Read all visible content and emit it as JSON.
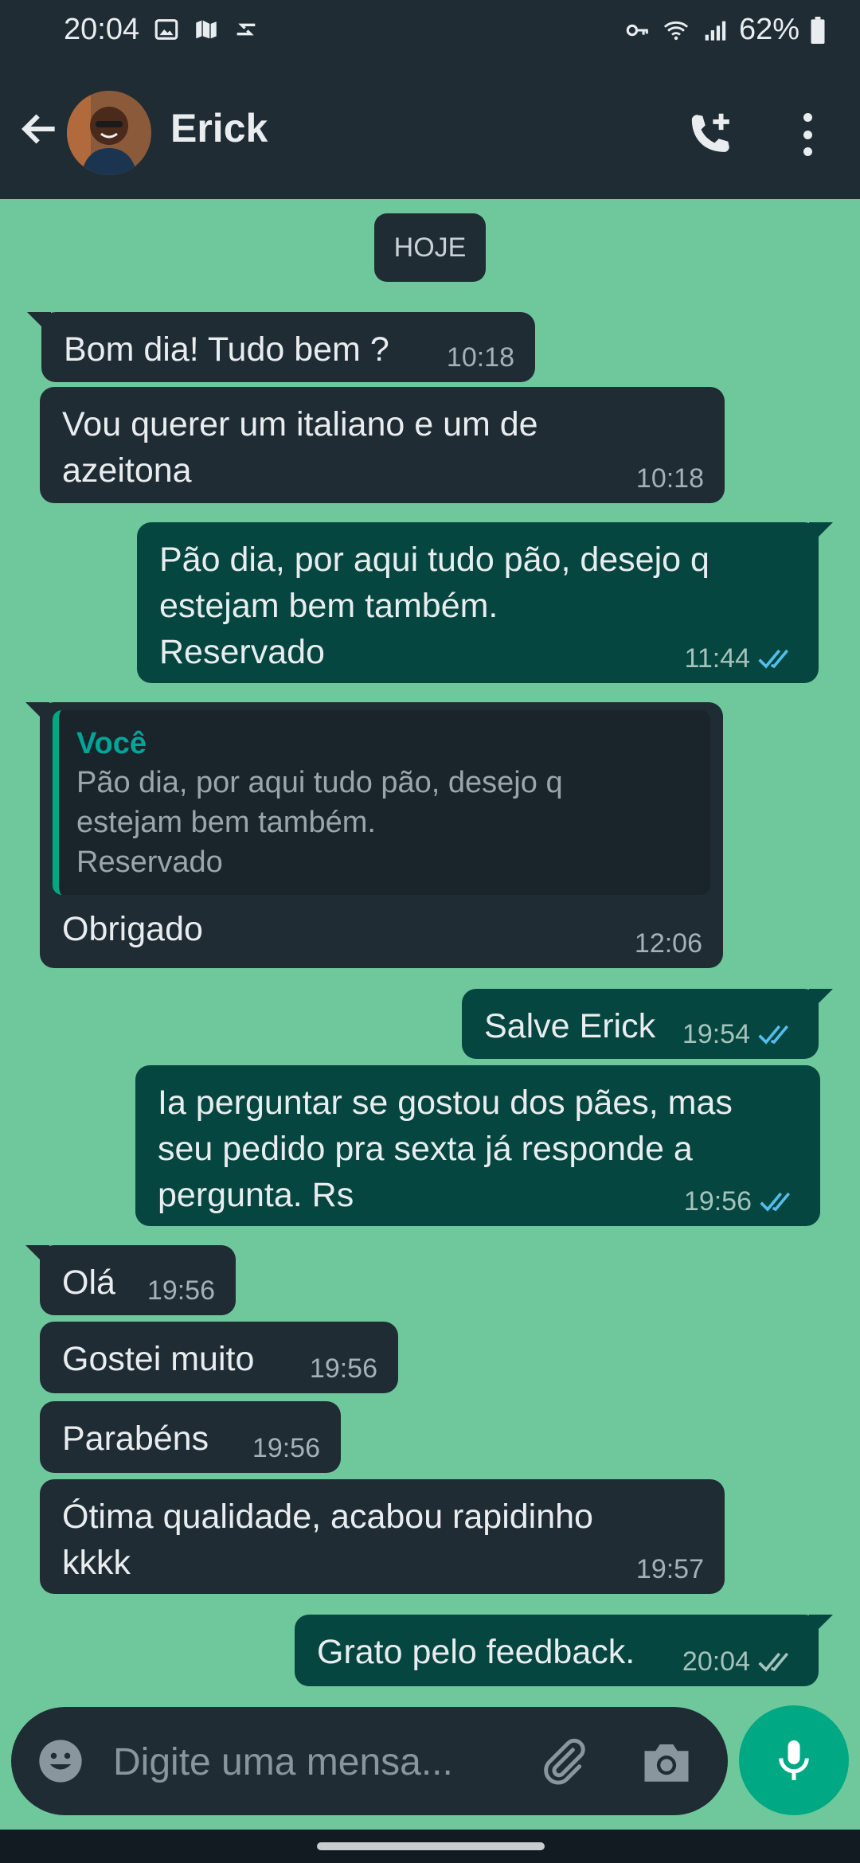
{
  "status_bar": {
    "time": "20:04",
    "battery": "62%",
    "left_icons": [
      "image-icon",
      "maps-icon",
      "transfer-icon"
    ],
    "right_icons": [
      "vpn-key-icon",
      "wifi-icon",
      "signal-icon",
      "battery-icon"
    ]
  },
  "header": {
    "contact_name": "Erick",
    "icons": [
      "back-arrow-icon",
      "add-call-icon",
      "more-vert-icon"
    ]
  },
  "date_chip": "HOJE",
  "messages": [
    {
      "direction": "in",
      "text": "Bom dia! Tudo bem ?",
      "time": "10:18"
    },
    {
      "direction": "in",
      "text": "Vou querer um italiano e um de\nazeitona",
      "time": "10:18"
    },
    {
      "direction": "out",
      "text": "Pão dia, por aqui tudo pão, desejo q\nestejam bem também.\nReservado",
      "time": "11:44",
      "status": "read"
    },
    {
      "direction": "in",
      "quote_author": "Você",
      "quote_text": "Pão dia, por aqui tudo pão, desejo q\nestejam bem também.\nReservado",
      "text": "Obrigado",
      "time": "12:06"
    },
    {
      "direction": "out",
      "text": "Salve Erick",
      "time": "19:54",
      "status": "read"
    },
    {
      "direction": "out",
      "text": "Ia perguntar se gostou dos pães, mas\nseu pedido pra sexta já responde a\npergunta. Rs",
      "time": "19:56",
      "status": "read"
    },
    {
      "direction": "in",
      "text": "Olá",
      "time": "19:56"
    },
    {
      "direction": "in",
      "text": "Gostei muito",
      "time": "19:56"
    },
    {
      "direction": "in",
      "text": "Parabéns",
      "time": "19:56"
    },
    {
      "direction": "in",
      "text": "Ótima qualidade, acabou rapidinho\nkkkk",
      "time": "19:57"
    },
    {
      "direction": "out",
      "text": "Grato pelo feedback.",
      "time": "20:04",
      "status": "delivered"
    }
  ],
  "composer": {
    "placeholder": "Digite uma mensa...",
    "icons": [
      "emoji-icon",
      "attach-icon",
      "camera-icon",
      "mic-icon"
    ]
  },
  "colors": {
    "chat_background": "#6fc89c",
    "header": "#1f2c34",
    "incoming_bubble": "#1f2c34",
    "outgoing_bubble": "#054640",
    "read_tick": "#53bdeb",
    "accent": "#00a884"
  }
}
